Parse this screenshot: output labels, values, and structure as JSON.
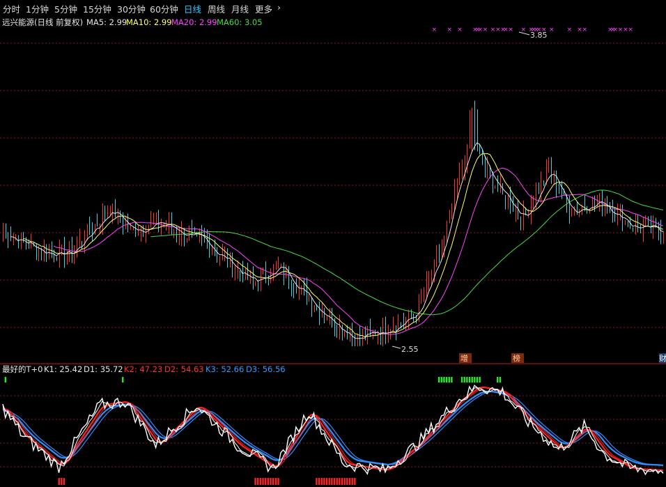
{
  "tabs": [
    {
      "label": "分时",
      "active": false
    },
    {
      "label": "1分钟",
      "active": false
    },
    {
      "label": "5分钟",
      "active": false
    },
    {
      "label": "15分钟",
      "active": false
    },
    {
      "label": "30分钟",
      "active": false
    },
    {
      "label": "60分钟",
      "active": false
    },
    {
      "label": "日线",
      "active": true
    },
    {
      "label": "周线",
      "active": false
    },
    {
      "label": "月线",
      "active": false
    },
    {
      "label": "更多",
      "active": false
    }
  ],
  "more_chevron": "chevron-right-icon",
  "main_legend": {
    "title": "远兴能源(日线 前复权)",
    "items": [
      {
        "text": "MA5: 2.99",
        "color": "#e6e6e6"
      },
      {
        "text": "MA10: 2.99",
        "color": "#ffff66"
      },
      {
        "text": "MA20: 2.99",
        "color": "#ff44ff"
      },
      {
        "text": "MA60: 3.05",
        "color": "#44dd44"
      }
    ]
  },
  "sub_legend": {
    "title": "最好的T+0",
    "items": [
      {
        "text": "K1: 25.42",
        "color": "#e6e6e6"
      },
      {
        "text": "D1: 35.72",
        "color": "#e6e6e6"
      },
      {
        "text": "K2: 47.23",
        "color": "#ff3333"
      },
      {
        "text": "D2: 54.63",
        "color": "#ff3333"
      },
      {
        "text": "K3: 52.66",
        "color": "#3399ff"
      },
      {
        "text": "D3: 56.56",
        "color": "#3399ff"
      }
    ]
  },
  "annotations": {
    "high": "3.85",
    "low": "2.55",
    "signal_labels": [
      "增",
      "榜",
      "财"
    ]
  },
  "colors": {
    "up": "#ff3333",
    "down": "#3ad6e6",
    "ma5": "#e6e6e6",
    "ma10": "#ffff66",
    "ma20": "#ff44ff",
    "ma60": "#44dd44",
    "grid": "#8a1a1a",
    "marker": "#ff44ff",
    "k1": "#ffffff",
    "k2": "#ff2020",
    "k3": "#2f8fff",
    "sig_green": "#22ee22",
    "sig_red": "#ff2222",
    "tab_active": "#35c9ff",
    "label_bg": "#7a2a10"
  },
  "chart_data": {
    "type": "line",
    "price_range": [
      2.55,
      3.85
    ],
    "price_key_points": [
      {
        "bar": 0,
        "close": 3.02
      },
      {
        "bar": 16,
        "close": 2.94
      },
      {
        "bar": 26,
        "close": 2.93
      },
      {
        "bar": 42,
        "close": 3.12
      },
      {
        "bar": 50,
        "close": 3.03
      },
      {
        "bar": 62,
        "close": 3.06
      },
      {
        "bar": 80,
        "close": 2.97
      },
      {
        "bar": 98,
        "close": 2.81
      },
      {
        "bar": 108,
        "close": 2.88
      },
      {
        "bar": 124,
        "close": 2.7
      },
      {
        "bar": 138,
        "close": 2.58
      },
      {
        "bar": 150,
        "close": 2.62
      },
      {
        "bar": 162,
        "close": 2.68
      },
      {
        "bar": 172,
        "close": 2.95
      },
      {
        "bar": 178,
        "close": 3.22
      },
      {
        "bar": 184,
        "close": 3.42
      },
      {
        "bar": 188,
        "close": 3.3
      },
      {
        "bar": 194,
        "close": 3.2
      },
      {
        "bar": 204,
        "close": 3.08
      },
      {
        "bar": 214,
        "close": 3.28
      },
      {
        "bar": 222,
        "close": 3.11
      },
      {
        "bar": 234,
        "close": 3.15
      },
      {
        "bar": 246,
        "close": 3.05
      },
      {
        "bar": 259,
        "close": 3.02
      }
    ],
    "bar_count": 260,
    "kd_range": [
      0,
      100
    ],
    "kd_key_points": [
      {
        "bar": 0,
        "k": 75
      },
      {
        "bar": 8,
        "k": 45
      },
      {
        "bar": 22,
        "k": 12
      },
      {
        "bar": 38,
        "k": 78
      },
      {
        "bar": 48,
        "k": 82
      },
      {
        "bar": 60,
        "k": 35
      },
      {
        "bar": 76,
        "k": 78
      },
      {
        "bar": 92,
        "k": 35
      },
      {
        "bar": 106,
        "k": 10
      },
      {
        "bar": 120,
        "k": 72
      },
      {
        "bar": 134,
        "k": 15
      },
      {
        "bar": 150,
        "k": 8
      },
      {
        "bar": 162,
        "k": 35
      },
      {
        "bar": 178,
        "k": 82
      },
      {
        "bar": 186,
        "k": 98
      },
      {
        "bar": 196,
        "k": 92
      },
      {
        "bar": 206,
        "k": 60
      },
      {
        "bar": 218,
        "k": 30
      },
      {
        "bar": 228,
        "k": 55
      },
      {
        "bar": 236,
        "k": 25
      },
      {
        "bar": 246,
        "k": 10
      },
      {
        "bar": 259,
        "k": 8
      }
    ],
    "green_signal_bars": [
      1,
      47,
      171,
      172,
      173,
      174,
      175,
      176,
      180,
      181,
      182,
      183,
      184,
      185,
      186,
      187,
      194,
      195
    ],
    "red_signal_bars": [
      22,
      23,
      24,
      99,
      100,
      101,
      102,
      103,
      104,
      105,
      106,
      107,
      108,
      123,
      124,
      125,
      126,
      127,
      128,
      129,
      130,
      131,
      132,
      133,
      134,
      135,
      136,
      137,
      138
    ],
    "x_marker_bars": [
      169,
      175,
      179,
      185,
      186,
      187,
      189,
      192,
      194,
      196,
      197,
      199,
      204,
      207,
      208,
      209,
      210,
      212,
      215,
      222,
      226,
      228,
      238,
      239,
      240,
      242,
      244,
      246
    ]
  }
}
